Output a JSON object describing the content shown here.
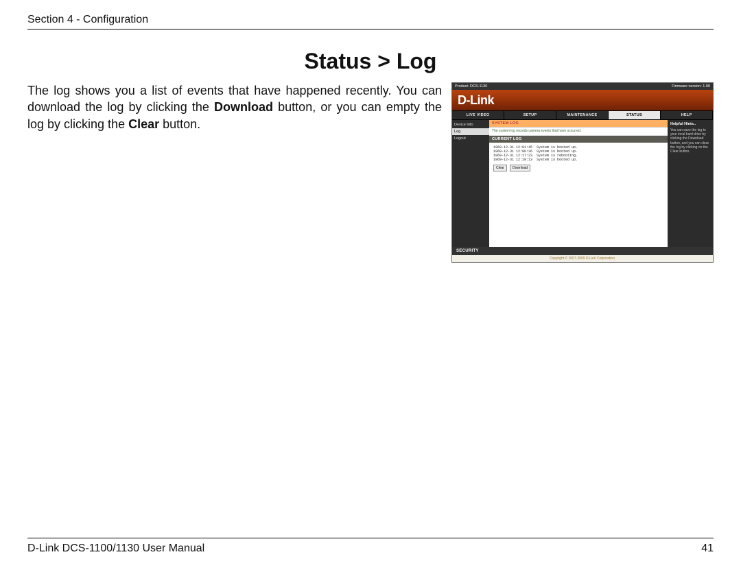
{
  "header": {
    "section": "Section 4 - Configuration"
  },
  "title": "Status > Log",
  "body": {
    "part1": "The log shows you a list of events that have happened recently. You can download the log by clicking the ",
    "bold1": "Download",
    "part2": " button, or you can empty the log by clicking the ",
    "bold2": "Clear",
    "part3": " button."
  },
  "screenshot": {
    "product": "Product: DCS-1130",
    "firmware": "Firmware version: 1.00",
    "brand": "D-Link",
    "tabs": [
      "LIVE VIDEO",
      "SETUP",
      "MAINTENANCE",
      "STATUS",
      "HELP"
    ],
    "active_tab": "STATUS",
    "sidebar": [
      "Device Info",
      "Log",
      "Logout"
    ],
    "active_side": "Log",
    "panel_system": "SYSTEM LOG",
    "panel_desc": "The system log records camera events that have occurred.",
    "panel_current": "CURRENT LOG",
    "log_lines": [
      "1969-12-31 12:01:45  System is booted up.",
      "1969-12-31 12:00:36  System is booted up.",
      "1969-12-31 12:17:23  System is rebooting.",
      "1969-12-31 12:18:13  System is booted up."
    ],
    "buttons": {
      "clear": "Clear",
      "download": "Download"
    },
    "help_title": "Helpful Hints..",
    "help_body": "You can save the log to your local hard drive by clicking the Download button, and you can clear the log by clicking on the Clear button.",
    "security": "SECURITY",
    "copyright": "Copyright © 2007-2009 D-Link Corporation."
  },
  "footer": {
    "left": "D-Link DCS-1100/1130 User Manual",
    "right": "41"
  }
}
